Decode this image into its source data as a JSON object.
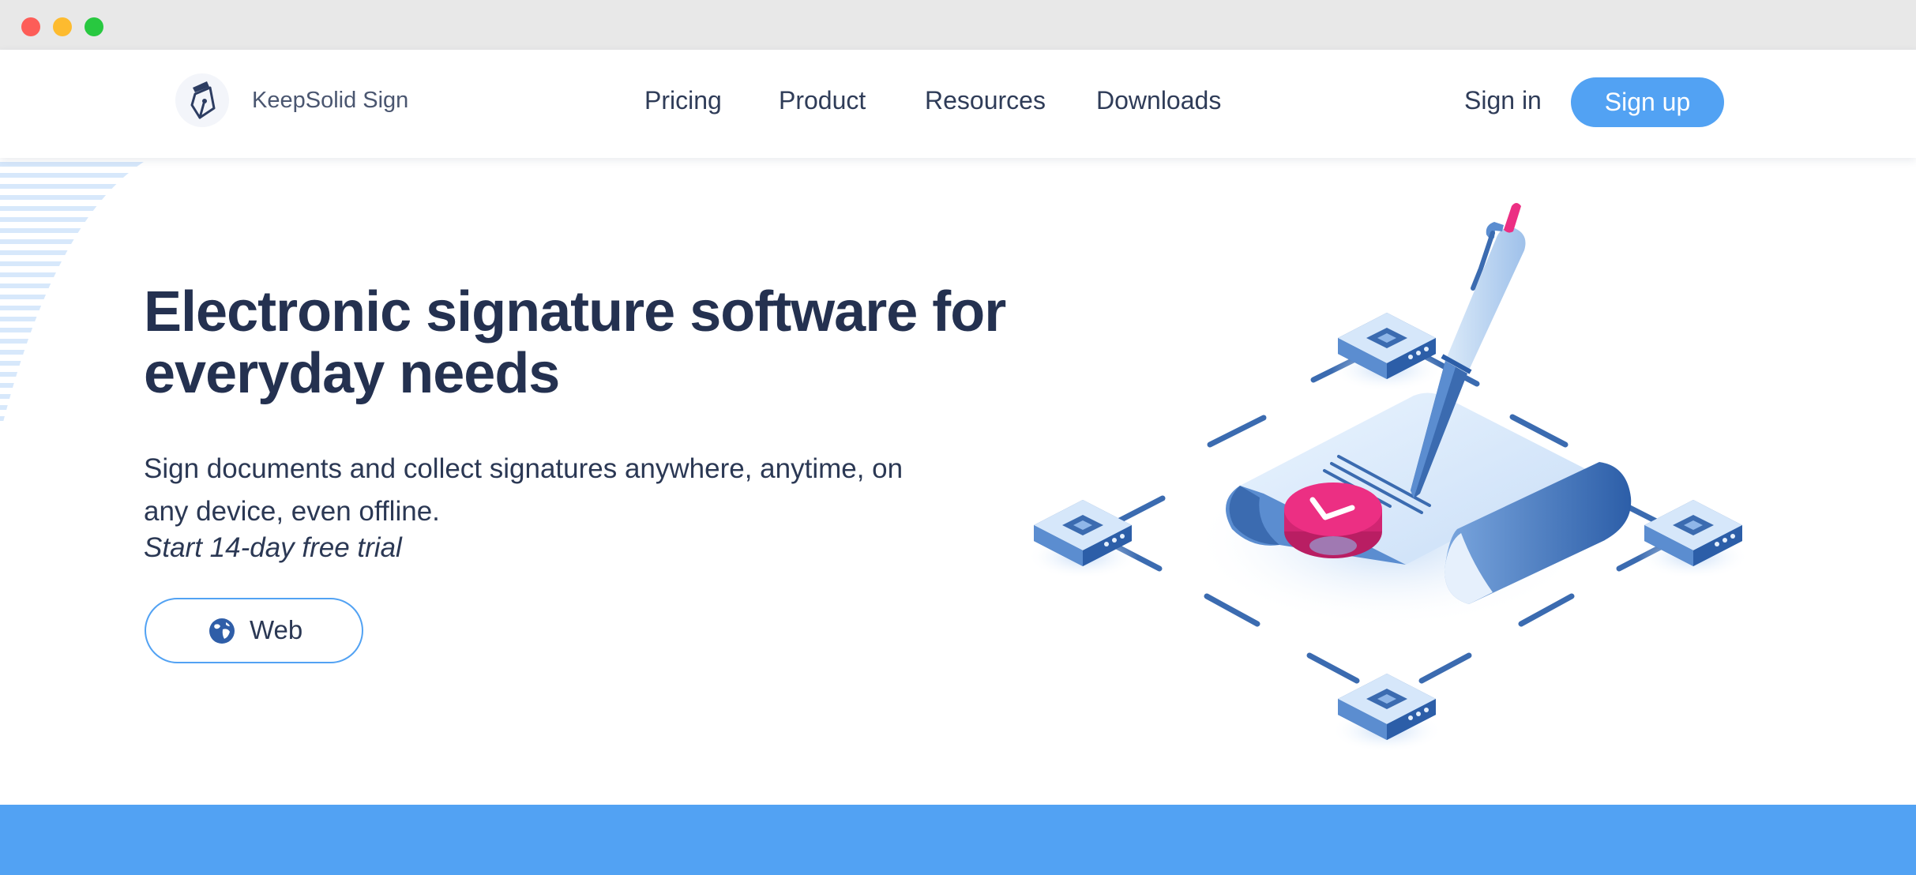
{
  "window": {
    "controls": [
      "close",
      "minimize",
      "zoom"
    ]
  },
  "header": {
    "brand_name": "KeepSolid Sign",
    "logo_icon": "pen-nib-logo-icon",
    "nav": [
      {
        "label": "Pricing"
      },
      {
        "label": "Product"
      },
      {
        "label": "Resources"
      },
      {
        "label": "Downloads"
      }
    ],
    "sign_in_label": "Sign in",
    "sign_up_label": "Sign up"
  },
  "hero": {
    "title": "Electronic signature software for everyday needs",
    "subtitle": "Sign documents and collect signatures anywhere, anytime, on any device, even offline.",
    "trial_text": "Start 14-day free trial",
    "web_button_label": "Web",
    "web_button_icon": "globe-icon"
  },
  "colors": {
    "accent": "#52a2f3",
    "text_dark": "#243150",
    "illustration_pink": "#ec2f83",
    "illustration_blue": "#3b6bb0"
  }
}
